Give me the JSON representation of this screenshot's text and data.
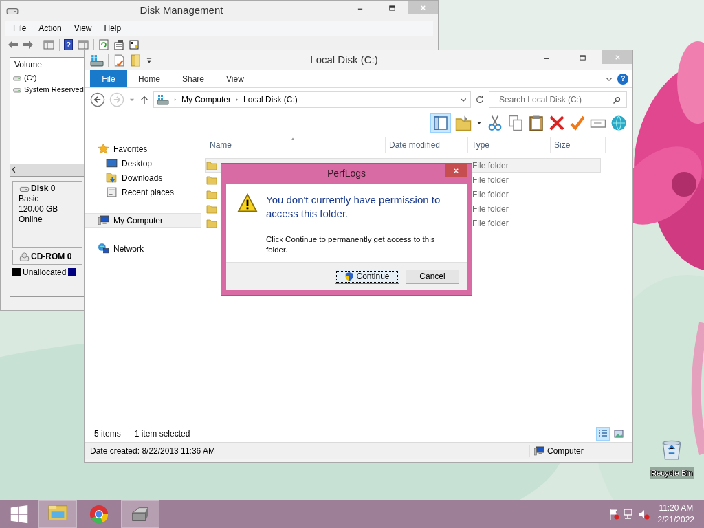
{
  "desktop": {
    "icons": [
      {
        "kind": "recycle",
        "label": "Recycle Bin"
      }
    ]
  },
  "disk_management": {
    "title": "Disk Management",
    "menu": [
      "File",
      "Action",
      "View",
      "Help"
    ],
    "help_glyph": "?",
    "volume_header": "Volume",
    "volumes": [
      "(C:)",
      "System Reserved"
    ],
    "disks": [
      {
        "kind": "disk",
        "name": "Disk 0",
        "lines": [
          "Basic",
          "120.00 GB",
          "Online"
        ]
      },
      {
        "kind": "cdrom",
        "name": "CD-ROM 0"
      }
    ],
    "legend": [
      {
        "label": "Unallocated",
        "color": "#000000"
      },
      {
        "color": "#000080"
      }
    ]
  },
  "explorer": {
    "title": "Local Disk (C:)",
    "ribbon_tabs": [
      {
        "label": "File",
        "selected": true
      },
      {
        "label": "Home",
        "selected": false
      },
      {
        "label": "Share",
        "selected": false
      },
      {
        "label": "View",
        "selected": false
      }
    ],
    "help_glyph": "?",
    "navigation": {
      "back_disabled": false,
      "forward_disabled": true
    },
    "breadcrumb": [
      "My Computer",
      "Local Disk (C:)"
    ],
    "search": {
      "placeholder": "Search Local Disk (C:)"
    },
    "preview_pane": {
      "on": true
    },
    "nav": [
      {
        "kind": "favorites",
        "label": "Favorites",
        "selected": false,
        "children": [
          {
            "kind": "desktop",
            "label": "Desktop",
            "selected": false
          },
          {
            "kind": "downloads",
            "label": "Downloads",
            "selected": false
          },
          {
            "kind": "recent",
            "label": "Recent places",
            "selected": false
          }
        ]
      },
      {
        "kind": "computer",
        "label": "My Computer",
        "selected": true
      },
      {
        "kind": "network",
        "label": "Network",
        "selected": false
      }
    ],
    "columns": [
      "Name",
      "Date modified",
      "Type",
      "Size"
    ],
    "rows": [
      {
        "type": "File folder",
        "selected": true
      },
      {
        "type": "File folder",
        "selected": false
      },
      {
        "type": "File folder",
        "selected": false
      },
      {
        "type": "File folder",
        "selected": false
      },
      {
        "type": "File folder",
        "selected": false
      }
    ],
    "status": {
      "items": "5 items",
      "selection": "1 item selected"
    },
    "view_buttons": [
      {
        "kind": "details",
        "selected": true
      },
      {
        "kind": "large",
        "selected": false
      }
    ],
    "details_bar": {
      "date_created": "Date created: 8/22/2013 11:36 AM",
      "location": "Computer"
    }
  },
  "dialog": {
    "title": "PerfLogs",
    "heading": "You don't currently have permission to access this folder.",
    "message": "Click Continue to permanently get access to this folder.",
    "buttons": [
      {
        "kind": "shield",
        "label": "Continue",
        "focused": true
      },
      {
        "kind": "plain",
        "label": "Cancel",
        "focused": false
      }
    ]
  },
  "taskbar": {
    "apps": [
      {
        "kind": "explorer",
        "selected": true
      },
      {
        "kind": "browser",
        "selected": false
      },
      {
        "kind": "disk",
        "selected": true
      }
    ],
    "clock": {
      "time": "11:20 AM",
      "date": "2/21/2022"
    }
  }
}
